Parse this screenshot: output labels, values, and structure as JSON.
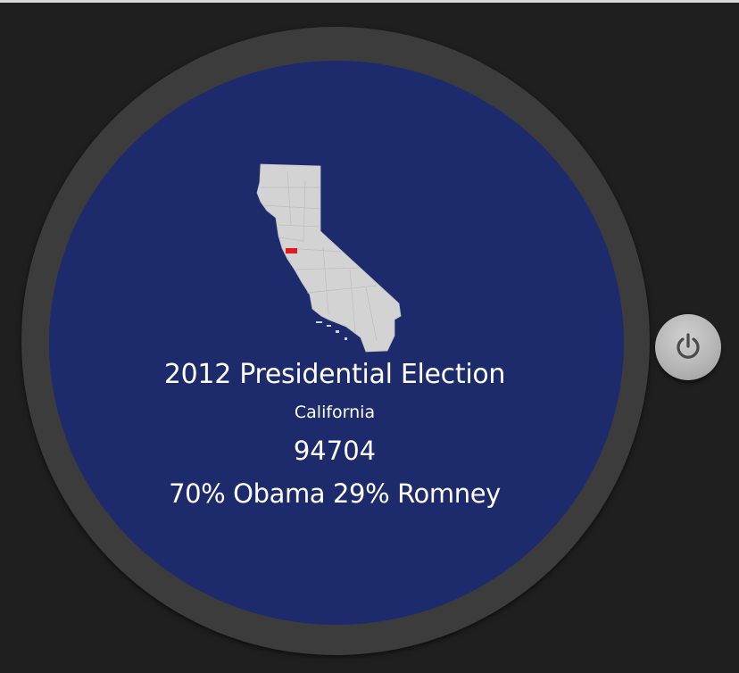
{
  "election": {
    "title": "2012 Presidential Election",
    "state": "California",
    "zip": "94704",
    "result": "70% Obama 29% Romney"
  },
  "map": {
    "icon": "california-map-icon",
    "highlight_color": "#e01b1b",
    "land_color": "#d3d3d3"
  },
  "colors": {
    "face": "#1d2a6b",
    "bezel": "#3b3b3b",
    "background": "#1f1f1f"
  },
  "controls": {
    "power_icon": "power-icon"
  }
}
